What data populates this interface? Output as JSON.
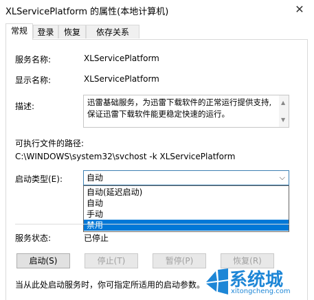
{
  "window": {
    "title": "XLServicePlatform 的属性(本地计算机)",
    "close": "✕"
  },
  "tabs": [
    "常规",
    "登录",
    "恢复",
    "依存关系"
  ],
  "fields": {
    "service_name_label": "服务名称:",
    "service_name_value": "XLServicePlatform",
    "display_name_label": "显示名称:",
    "display_name_value": "XLServicePlatform",
    "description_label": "描述:",
    "description_line1": "迅雷基础服务，为迅雷下载软件的正常运行提供支持,",
    "description_line2": "保证迅雷下载软件能更稳定快速的运行。",
    "path_label": "可执行文件的路径:",
    "path_value": "C:\\WINDOWS\\system32\\svchost -k XLServicePlatform",
    "startup_type_label": "启动类型(E):",
    "startup_type_value": "自动",
    "startup_options": [
      "自动(延迟启动)",
      "自动",
      "手动",
      "禁用"
    ],
    "startup_selected_index": 3,
    "service_status_label": "服务状态:",
    "service_status_value": "已停止"
  },
  "buttons": {
    "start": "启动(S)",
    "stop": "停止(T)",
    "pause": "暂停(P)",
    "resume": "恢复(R)"
  },
  "hint": "当从此处启动服务时，你可指定所适用的启动参数。",
  "watermark": {
    "text": "系统城",
    "url": "xitongcheng.com",
    "color": "#1d86d6"
  }
}
